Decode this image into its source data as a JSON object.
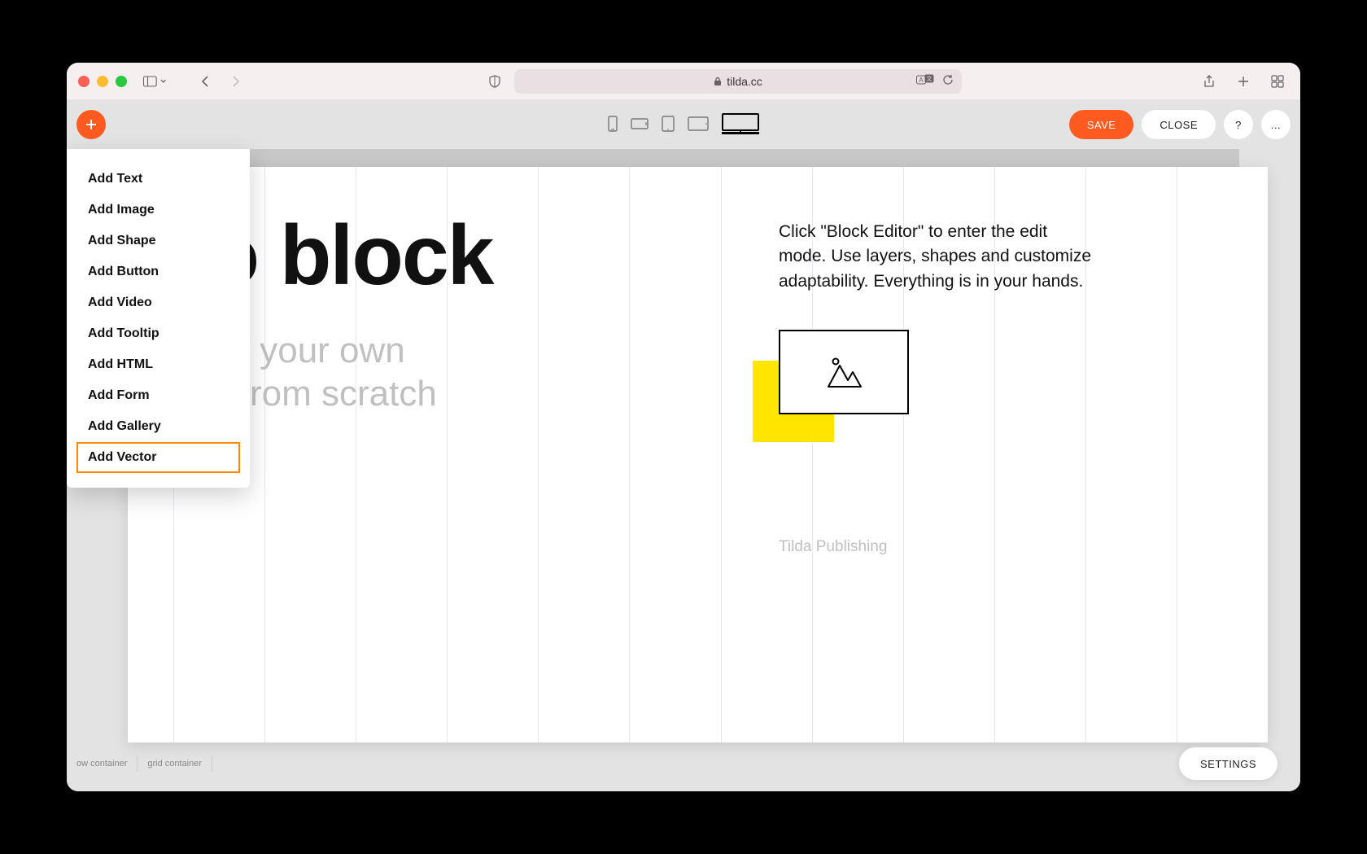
{
  "browser": {
    "url_host": "tilda.cc"
  },
  "toolbar": {
    "save_label": "SAVE",
    "close_label": "CLOSE",
    "help_label": "?",
    "more_label": "..."
  },
  "add_menu": {
    "items": [
      {
        "label": "Add Text",
        "highlight": false
      },
      {
        "label": "Add Image",
        "highlight": false
      },
      {
        "label": "Add Shape",
        "highlight": false
      },
      {
        "label": "Add Button",
        "highlight": false
      },
      {
        "label": "Add Video",
        "highlight": false
      },
      {
        "label": "Add Tooltip",
        "highlight": false
      },
      {
        "label": "Add HTML",
        "highlight": false
      },
      {
        "label": "Add Form",
        "highlight": false
      },
      {
        "label": "Add Gallery",
        "highlight": false
      },
      {
        "label": "Add Vector",
        "highlight": true
      }
    ]
  },
  "canvas": {
    "hero_title": "ro block",
    "hero_sub": " your own\nrom scratch",
    "hero_copy": "Click \"Block Editor\" to enter the edit mode. Use layers, shapes and customize adaptability. Everything is in your hands.",
    "brand": "Tilda Publishing"
  },
  "footer": {
    "window_container": "ow container",
    "grid_container": "grid container",
    "settings_label": "SETTINGS"
  },
  "colors": {
    "accent": "#ff5a1f",
    "highlight_border": "#ff8a00",
    "yellow": "#ffe600"
  }
}
